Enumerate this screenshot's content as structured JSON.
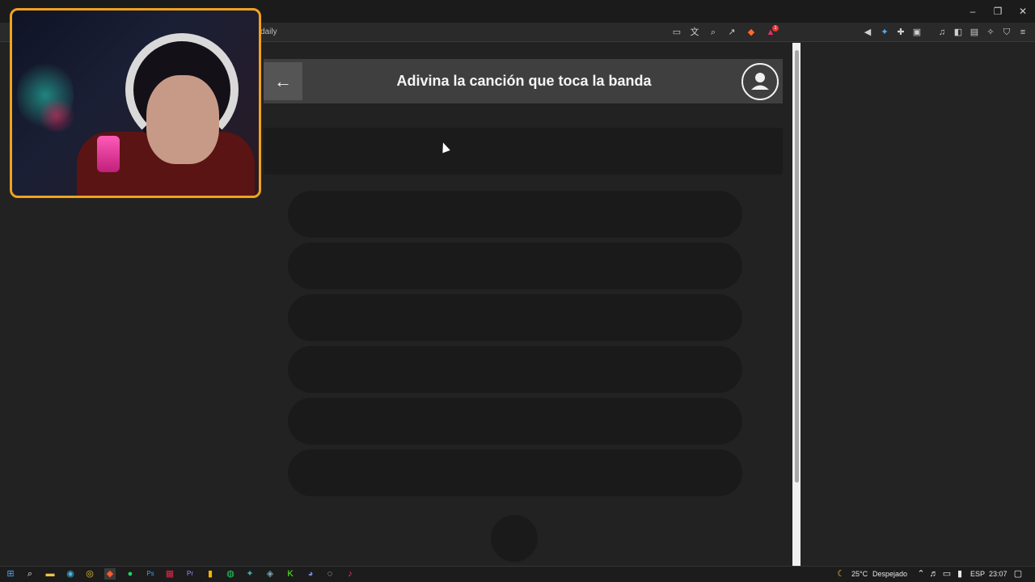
{
  "browser": {
    "address_text": "daily",
    "window_controls": {
      "minimize": "–",
      "restore": "❐",
      "close": "✕"
    },
    "toolbar_icons": [
      "cast-icon",
      "translate-icon",
      "zoom-icon",
      "share-icon",
      "brave-shield-icon",
      "brave-rewards-icon"
    ],
    "extension_icons": [
      "mute-icon",
      "extension-icon",
      "puzzle-icon",
      "tab-icon",
      "music-icon",
      "sidebar-icon",
      "wallet-icon",
      "leo-icon",
      "vpn-icon",
      "menu-icon"
    ],
    "rewards_badge": "1"
  },
  "page": {
    "back_label": "←",
    "title": "Adivina la canción que toca la banda",
    "options": [
      "",
      "",
      "",
      "",
      "",
      ""
    ]
  },
  "taskbar": {
    "apps": [
      "start-icon",
      "search-icon",
      "files-icon",
      "edge-icon",
      "chrome-icon",
      "brave-icon",
      "spotify-icon",
      "photoshop-icon",
      "app-icon",
      "premiere-icon",
      "app-icon",
      "whatsapp-icon",
      "app-icon",
      "app-icon",
      "app-icon",
      "discord-icon",
      "app-icon",
      "tiktok-icon"
    ],
    "weather_temp": "25°C",
    "weather_desc": "Despejado",
    "language": "ESP",
    "time": "23:07"
  },
  "colors": {
    "webcam_border": "#f0a21f",
    "page_bg": "#222222",
    "header_bg": "#3f3f3f"
  }
}
